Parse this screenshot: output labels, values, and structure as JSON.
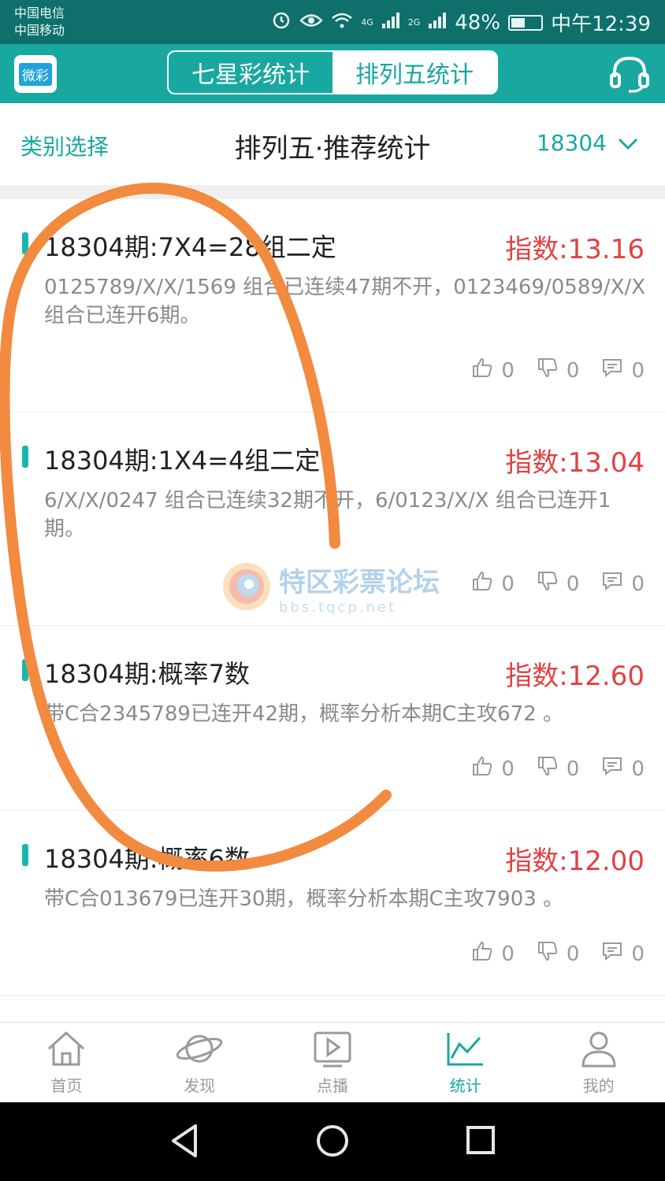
{
  "status_bar": {
    "carrier1": "中国电信",
    "carrier2": "中国移动",
    "net1": "4G",
    "net2": "2G",
    "battery_text": "48%",
    "battery_level": 0.48,
    "time": "中午12:39"
  },
  "appbar": {
    "logo_text": "微彩",
    "tabs": [
      {
        "label": "七星彩统计",
        "active": false
      },
      {
        "label": "排列五统计",
        "active": true
      }
    ],
    "headset_icon": "headset-icon"
  },
  "subheader": {
    "category_label": "类别选择",
    "title": "排列五·推荐统计",
    "issue_value": "18304"
  },
  "cards": [
    {
      "title": "18304期:7X4=28组二定",
      "index": "指数:13.16",
      "desc": "0125789/X/X/1569 组合已连续47期不开，0123469/0589/X/X 组合已连开6期。",
      "likes": "0",
      "dislikes": "0",
      "comments": "0"
    },
    {
      "title": "18304期:1X4=4组二定",
      "index": "指数:13.04",
      "desc": "6/X/X/0247 组合已连续32期不开，6/0123/X/X 组合已连开1期。",
      "likes": "0",
      "dislikes": "0",
      "comments": "0"
    },
    {
      "title": "18304期:概率7数",
      "index": "指数:12.60",
      "desc": "带C合2345789已连开42期，概率分析本期C主攻672 。",
      "likes": "0",
      "dislikes": "0",
      "comments": "0"
    },
    {
      "title": "18304期:概率6数",
      "index": "指数:12.00",
      "desc": "带C合013679已连开30期，概率分析本期C主攻7903 。",
      "likes": "0",
      "dislikes": "0",
      "comments": "0"
    }
  ],
  "watermark": {
    "title": "特区彩票论坛",
    "url": "bbs.tqcp.net"
  },
  "bottom_nav": [
    {
      "label": "首页",
      "icon": "home-icon",
      "active": false
    },
    {
      "label": "发现",
      "icon": "planet-icon",
      "active": false
    },
    {
      "label": "点播",
      "icon": "play-icon",
      "active": false
    },
    {
      "label": "统计",
      "icon": "chart-icon",
      "active": true
    },
    {
      "label": "我的",
      "icon": "user-icon",
      "active": false
    }
  ],
  "colors": {
    "teal": "#18a8a0",
    "status_bg": "#0f6f6a",
    "red_index": "#e04242",
    "annotation": "#f28a3f"
  }
}
